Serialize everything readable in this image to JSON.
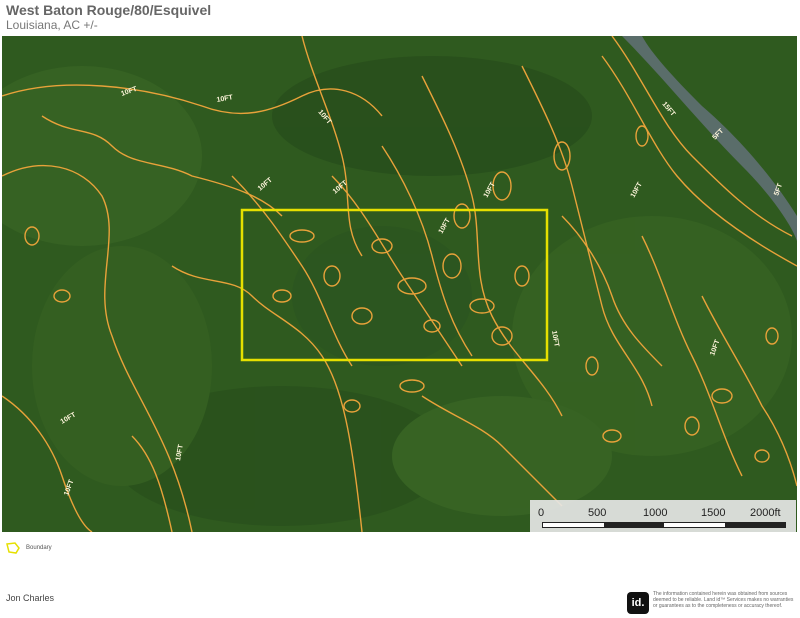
{
  "header": {
    "title": "West Baton Rouge/80/Esquivel",
    "subtitle": "Louisiana,  AC +/-"
  },
  "map": {
    "contour_labels": [
      "10FT",
      "10FT",
      "10FT",
      "10FT",
      "10FT",
      "10FT",
      "10FT",
      "10FT",
      "10FT",
      "10FT",
      "10FT",
      "10FT",
      "10FT",
      "15FT",
      "5FT",
      "5FT"
    ],
    "colors": {
      "contour": "#e8a23a",
      "boundary": "#e6e000",
      "forest": "#2f5a1f"
    }
  },
  "scale_bar": {
    "labels": [
      "0",
      "500",
      "1000",
      "1500",
      "2000ft"
    ]
  },
  "legend": {
    "boundary_label": "Boundary",
    "boundary_icon": "polygon-icon"
  },
  "footer": {
    "agent": "Jon Charles",
    "logo": "id.",
    "disclaimer": "The information contained herein was obtained from sources deemed to be reliable. Land id™ Services makes no warranties or guarantees as to the completeness or accuracy thereof."
  }
}
